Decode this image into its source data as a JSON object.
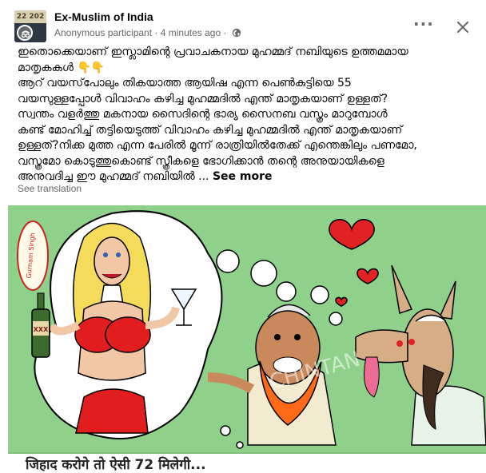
{
  "header": {
    "avatar_text": "22  202",
    "group_name": "Ex-Muslim of India",
    "author": "Anonymous participant",
    "separator": "·",
    "timestamp": "4 minutes ago",
    "separator2": "·",
    "privacy_icon": "globe-icon",
    "more_label": "···",
    "close_icon": "close-icon"
  },
  "post": {
    "lines": [
      "ഇതൊക്കെയാണ് ഇസ്ലാമിന്റെ പ്രവാചകനായ മുഹമ്മദ് നബിയുടെ ഉത്തമമായ",
      "മാതൃകകൾ",
      "ആറ് വയസ്‌പോലും തികയാത്ത ആയിഷ എന്ന പെൺകുട്ടിയെ 55",
      "വയസുള്ളപ്പോൾ വിവാഹം കഴിച്ച മുഹമ്മദിൽ എന്ത് മാതൃകയാണ് ഉള്ളത്?",
      "സ്വന്തം വളർത്തു മകനായ സൈദിന്റെ ഭാര്യ സൈനബ വസ്ത്രം മാറുമ്പോൾ",
      "കണ്ട് മോഹിച്ച് തട്ടിയെടുത്ത് വിവാഹം കഴിച്ച മുഹമ്മദിൽ എന്ത് മാതൃകയാണ്",
      "ഉള്ളത്?നിക്ക മുത്ത എന്ന പേരിൽ മൂന്ന് രാത്രിയിൽതേക്ക് എന്തെങ്കിലും പണമോ,",
      "വസ്ത്രമോ കൊടുത്തുകൊണ്ട് സ്ത്രീകളെ ഭോഗിക്കാൻ തന്റെ അനുയായികളെ",
      "അനുവദിച്ച ഈ മുഹമ്മദ് നബിയിൽ ..."
    ],
    "emoji": "👇👇",
    "see_more": "See more",
    "see_translation": "See translation"
  },
  "image": {
    "stamp_text": "Gurnam Singh",
    "bottle_label": "XXX",
    "caption": "जिहाद करोगे तो ऐसी 72 मिलेगी...",
    "colors": {
      "background": "#8fd18b",
      "skin": "#c9895a",
      "beard": "#ff6a18",
      "heart": "#e22222",
      "dress": "#e21d1d",
      "hair": "#f4dc5a"
    }
  }
}
